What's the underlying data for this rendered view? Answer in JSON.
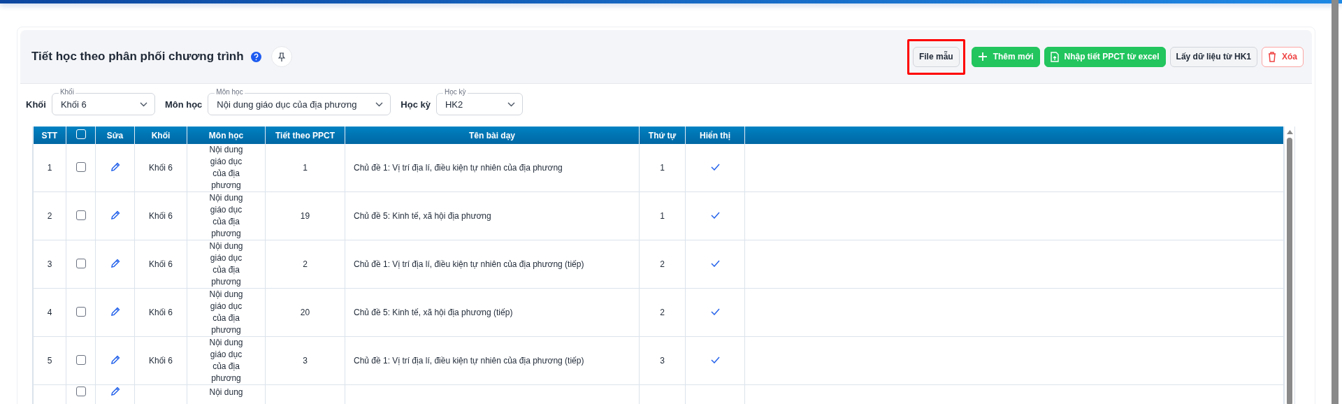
{
  "page_title": "Tiết học theo phân phối chương trình",
  "buttons": [
    {
      "label": "File mẫu",
      "kind": "outline",
      "highlighted": true
    },
    {
      "label": "Thêm mới",
      "kind": "primary",
      "highlighted": false
    },
    {
      "label": "Nhập tiết PPCT từ excel",
      "kind": "primary",
      "highlighted": false
    },
    {
      "label": "Lấy dữ liệu từ HK1",
      "kind": "outline",
      "highlighted": false
    },
    {
      "label": "Xóa",
      "kind": "danger",
      "highlighted": false
    }
  ],
  "filters": [
    {
      "label": "Khối",
      "floating_label": "Khối",
      "value": "Khối 6"
    },
    {
      "label": "Môn học",
      "floating_label": "Môn học",
      "value": "Nội dung giáo dục của địa phương"
    },
    {
      "label": "Học kỳ",
      "floating_label": "Học kỳ",
      "value": "HK2"
    }
  ],
  "table": {
    "columns": [
      "STT",
      "Sửa",
      "Khối",
      "Môn học",
      "Tiết theo PPCT",
      "Tên bài dạy",
      "Thứ tự",
      "Hiển thị"
    ],
    "select_all_checked": false,
    "rows": [
      {
        "stt": "1",
        "checked": false,
        "khoi": "Khối 6",
        "mon_hoc": "Nội dung giáo dục của địa phương",
        "tiet": "1",
        "ten_bai": "Chủ đề 1: Vị trí địa lí, điều kiện tự nhiên của địa phương",
        "thu_tu": "1",
        "shown": true
      },
      {
        "stt": "2",
        "checked": false,
        "khoi": "Khối 6",
        "mon_hoc": "Nội dung giáo dục của địa phương",
        "tiet": "19",
        "ten_bai": "Chủ đề 5: Kinh tế, xã hội địa phương",
        "thu_tu": "1",
        "shown": true
      },
      {
        "stt": "3",
        "checked": false,
        "khoi": "Khối 6",
        "mon_hoc": "Nội dung giáo dục của địa phương",
        "tiet": "2",
        "ten_bai": "Chủ đề 1: Vị trí địa lí, điều kiện tự nhiên của địa phương (tiếp)",
        "thu_tu": "2",
        "shown": true
      },
      {
        "stt": "4",
        "checked": false,
        "khoi": "Khối 6",
        "mon_hoc": "Nội dung giáo dục của địa phương",
        "tiet": "20",
        "ten_bai": "Chủ đề 5: Kinh tế, xã hội địa phương (tiếp)",
        "thu_tu": "2",
        "shown": true
      },
      {
        "stt": "5",
        "checked": false,
        "khoi": "Khối 6",
        "mon_hoc": "Nội dung giáo dục của địa phương",
        "tiet": "3",
        "ten_bai": "Chủ đề 1: Vị trí địa lí, điều kiện tự nhiên của địa phương (tiếp)",
        "thu_tu": "3",
        "shown": true
      },
      {
        "checked": false,
        "mon_hoc": "Nội dung"
      }
    ]
  }
}
